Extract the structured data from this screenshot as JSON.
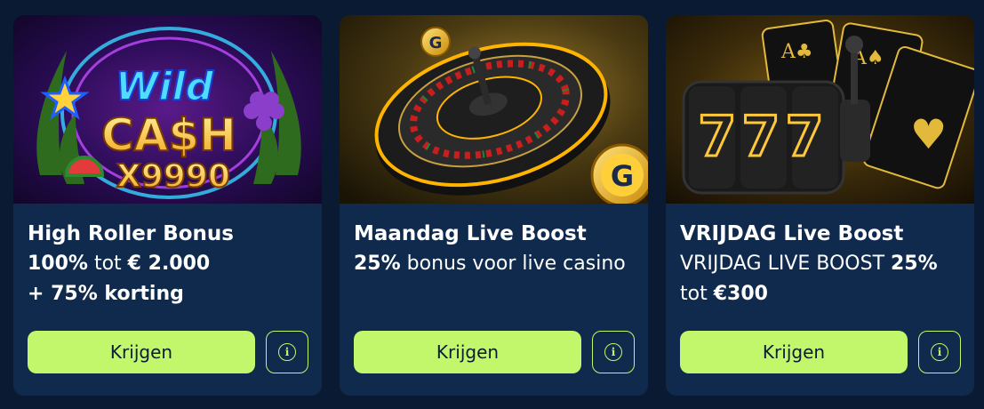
{
  "cards": [
    {
      "art_text": {
        "line1": "Wild",
        "line2": "CA$H",
        "line3": "X9990"
      },
      "title": "High Roller Bonus",
      "desc": [
        {
          "text": "100%",
          "bold": true
        },
        {
          "text": " tot ",
          "bold": false
        },
        {
          "text": "€ 2.000",
          "bold": true
        },
        {
          "text": " + 75% korting",
          "bold": true
        }
      ],
      "button": "Krijgen",
      "info": "i"
    },
    {
      "art_text": {
        "chip": "G"
      },
      "title": "Maandag Live Boost",
      "desc": [
        {
          "text": "25%",
          "bold": true
        },
        {
          "text": " bonus voor live casino",
          "bold": false
        }
      ],
      "button": "Krijgen",
      "info": "i"
    },
    {
      "art_text": {
        "reels": "777"
      },
      "title": "VRIJDAG Live Boost",
      "desc": [
        {
          "text": "VRIJDAG LIVE BOOST ",
          "bold": false
        },
        {
          "text": "25%",
          "bold": true
        },
        {
          "text": " tot ",
          "bold": false
        },
        {
          "text": "€300",
          "bold": true
        }
      ],
      "button": "Krijgen",
      "info": "i"
    }
  ],
  "colors": {
    "page_bg": "#0a1a33",
    "card_bg": "#0f2a4d",
    "accent": "#c2f76b",
    "button_text": "#0b1c35"
  }
}
